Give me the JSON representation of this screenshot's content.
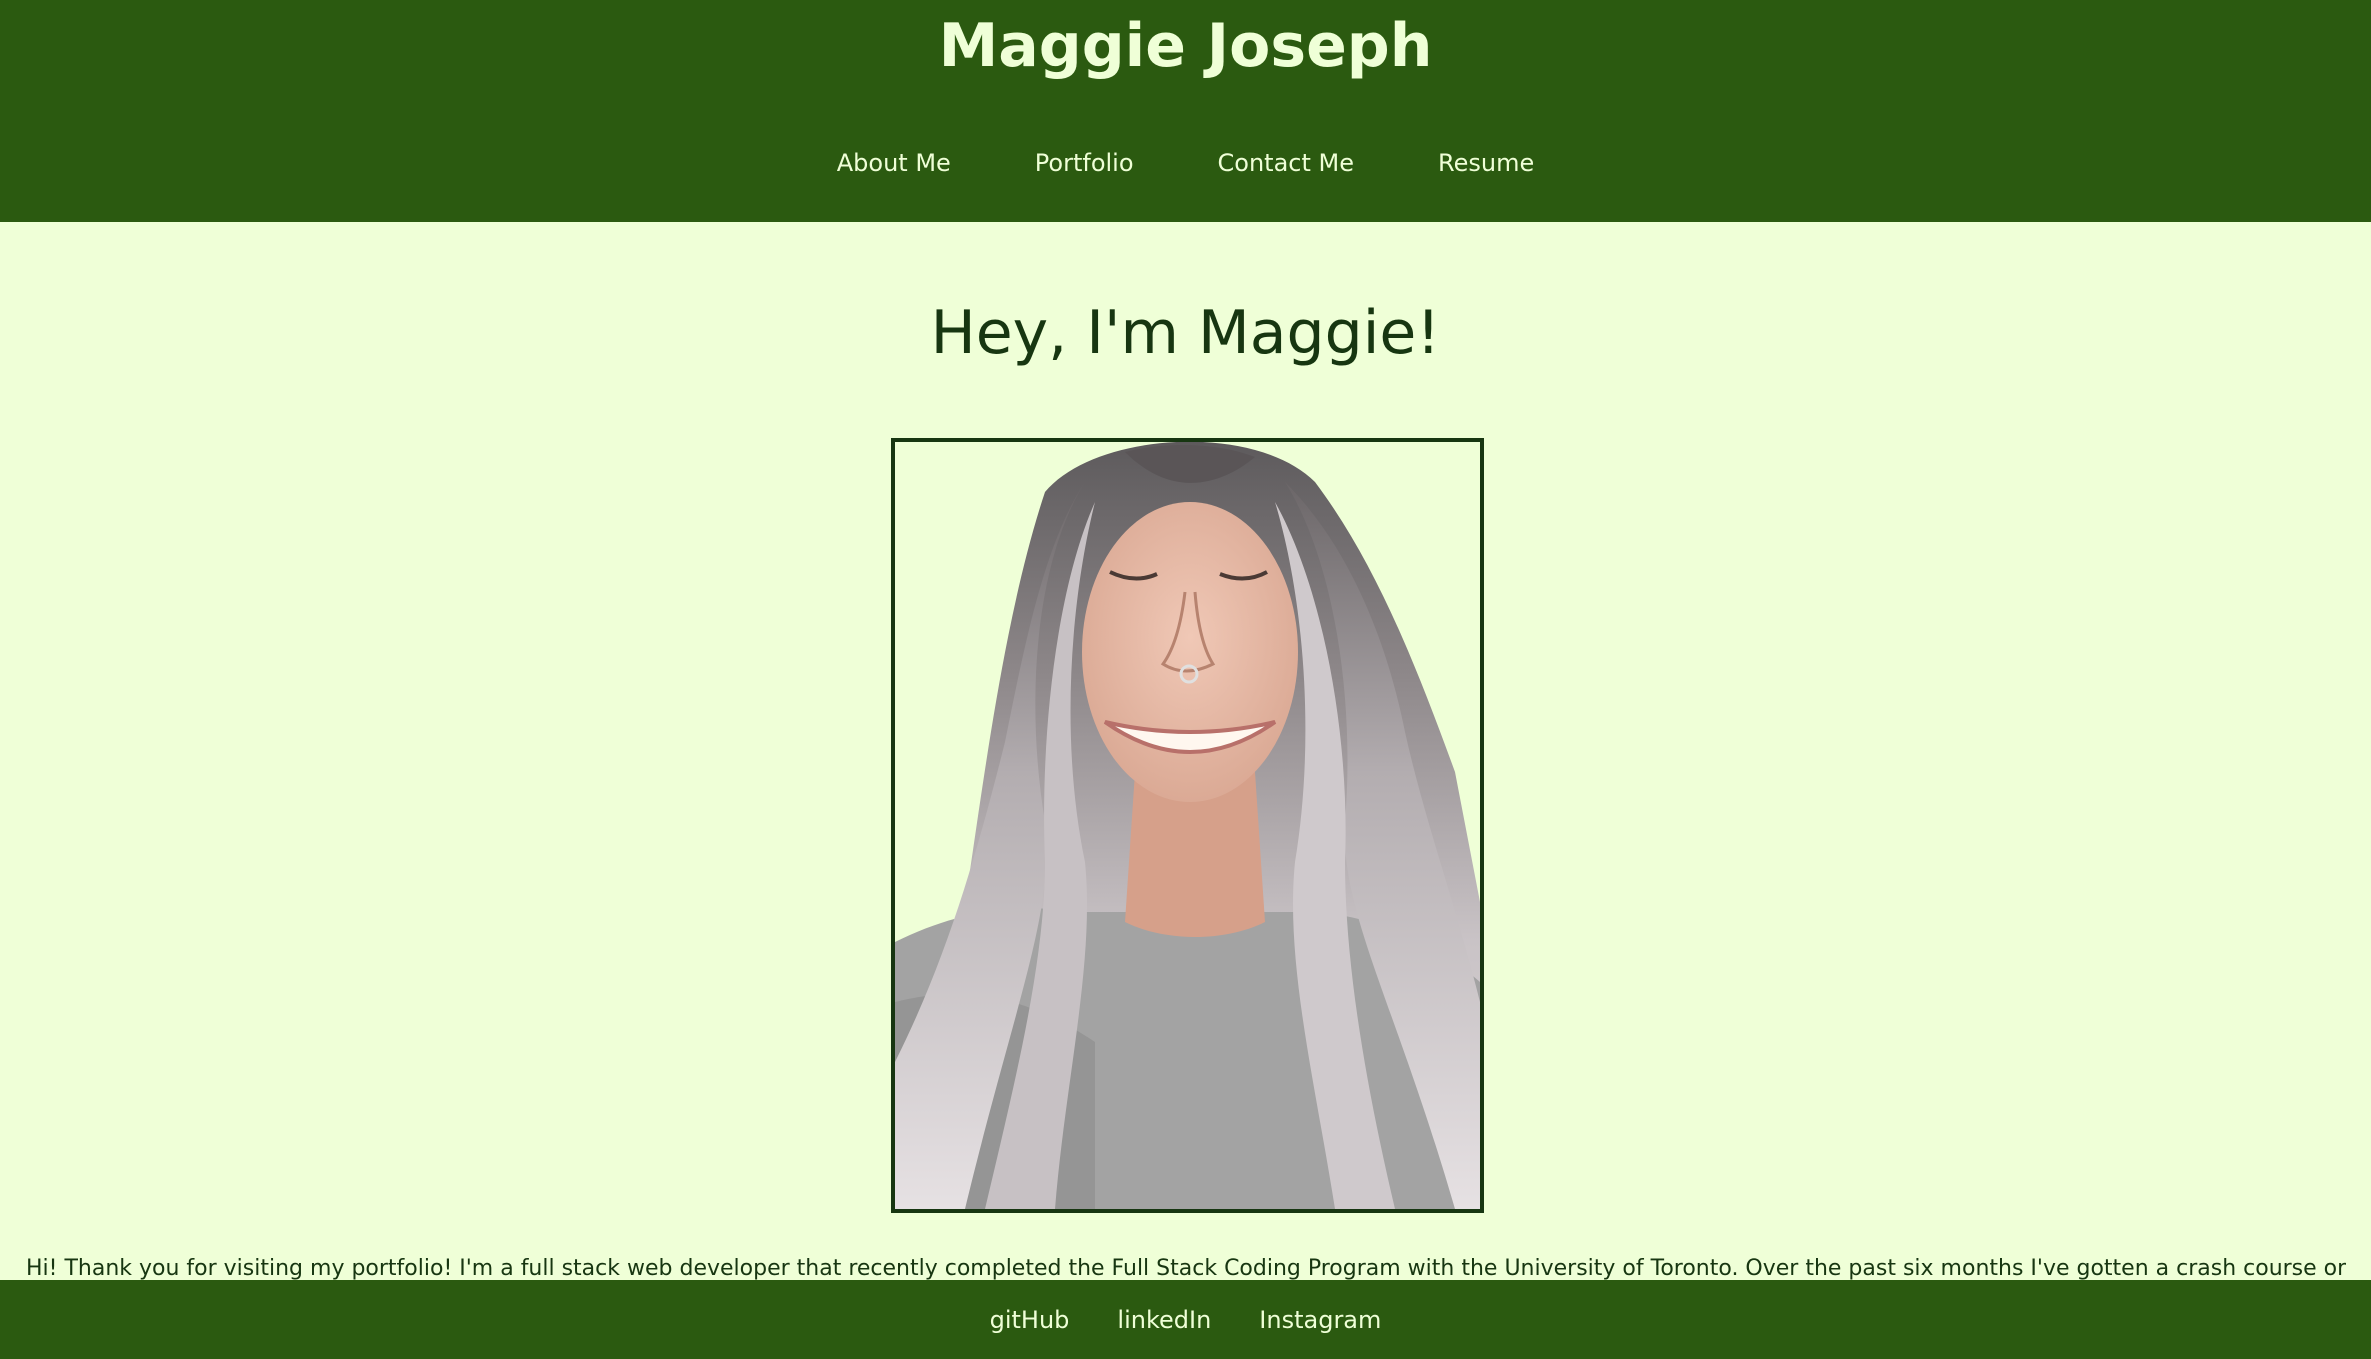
{
  "header": {
    "title": "Maggie Joseph",
    "nav": [
      {
        "label": "About Me"
      },
      {
        "label": "Portfolio"
      },
      {
        "label": "Contact Me"
      },
      {
        "label": "Resume"
      }
    ]
  },
  "main": {
    "heading": "Hey, I'm Maggie!",
    "intro": "Hi! Thank you for visiting my portfolio! I'm a full stack web developer that recently completed the Full Stack Coding Program with the University of Toronto. Over the past six months I've gotten a crash course on all things"
  },
  "footer": {
    "links": [
      {
        "label": "gitHub"
      },
      {
        "label": "linkedIn"
      },
      {
        "label": "Instagram"
      }
    ]
  },
  "colors": {
    "header_bg": "#2b5a10",
    "page_bg": "#efffd7",
    "text_light": "#efffd7",
    "text_dark": "#173611"
  }
}
